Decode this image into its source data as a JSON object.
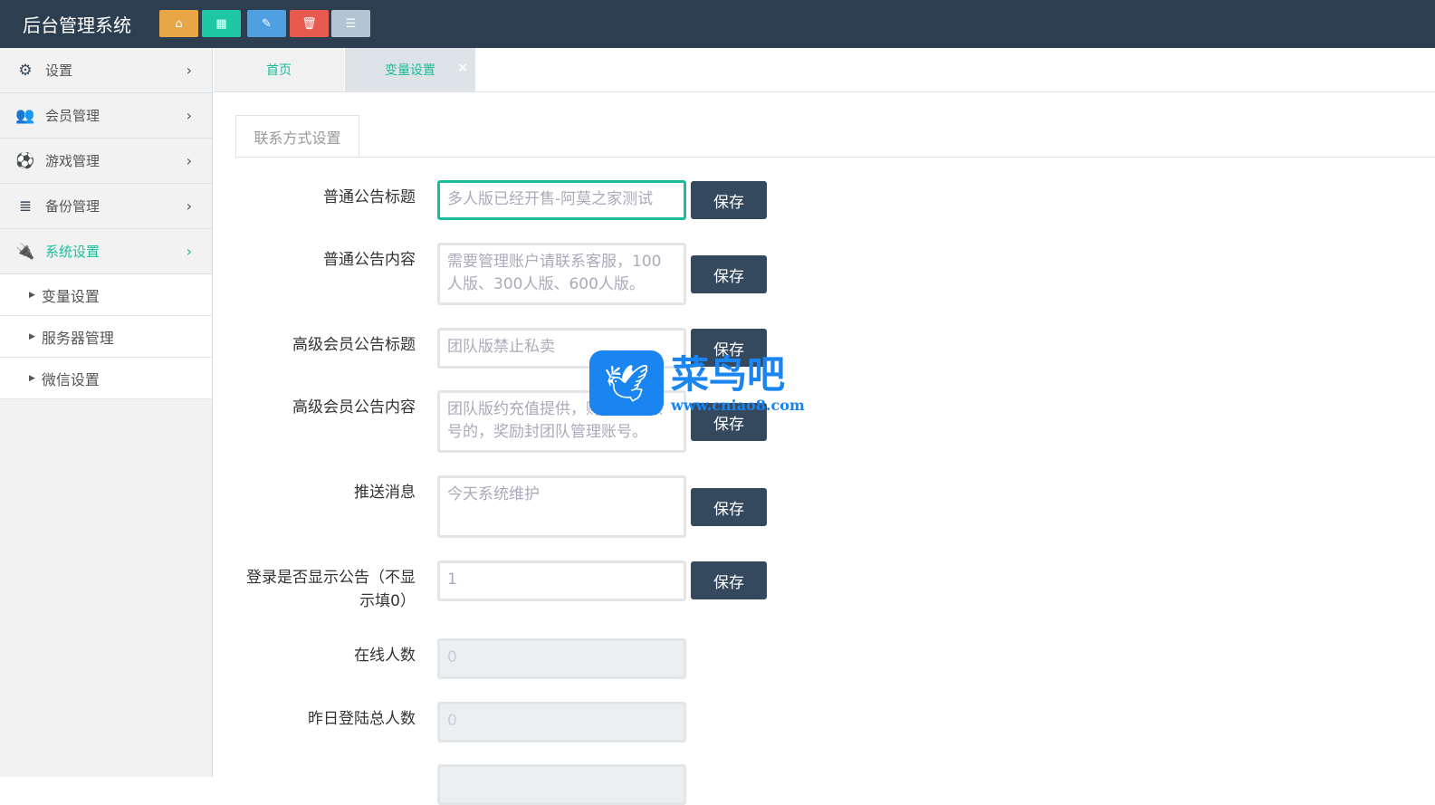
{
  "header": {
    "title": "后台管理系统",
    "buttons": [
      {
        "icon": "home-icon",
        "color": "#e8a646"
      },
      {
        "icon": "grid-icon",
        "color": "#1fc8a5"
      },
      {
        "icon": "pencil-icon",
        "color": "#4f9fe3"
      },
      {
        "icon": "trash-icon",
        "color": "#e65a4f"
      },
      {
        "icon": "list-icon",
        "color": "#b3c5d3"
      }
    ]
  },
  "sidebar": {
    "items": [
      {
        "label": "设置",
        "icon": "gears-icon"
      },
      {
        "label": "会员管理",
        "icon": "users-icon"
      },
      {
        "label": "游戏管理",
        "icon": "soccer-icon"
      },
      {
        "label": "备份管理",
        "icon": "database-icon"
      },
      {
        "label": "系统设置",
        "icon": "plug-icon"
      }
    ],
    "subitems": [
      {
        "label": "变量设置"
      },
      {
        "label": "服务器管理"
      },
      {
        "label": "微信设置"
      }
    ]
  },
  "tabs": [
    {
      "label": "首页"
    },
    {
      "label": "变量设置",
      "close": "×"
    }
  ],
  "panel_tab": "联系方式设置",
  "form": {
    "save": "保存",
    "rows": [
      {
        "label": "普通公告标题",
        "value": "多人版已经开售-阿莫之家测试"
      },
      {
        "label": "普通公告内容",
        "value": "需要管理账户请联系客服，100人版、300人版、600人版。"
      },
      {
        "label": "高级会员公告标题",
        "value": "团队版禁止私卖"
      },
      {
        "label": "高级会员公告内容",
        "value": "团队版约充值提供，购买会员账号的，奖励封团队管理账号。"
      },
      {
        "label": "推送消息",
        "value": "今天系统维护"
      },
      {
        "label": "登录是否显示公告（不显示填0）",
        "value": "1"
      },
      {
        "label": "在线人数",
        "value": "0"
      },
      {
        "label": "昨日登陆总人数",
        "value": "0"
      }
    ]
  },
  "watermark": {
    "name": "菜鸟吧",
    "url": "www.cniao8.com"
  }
}
